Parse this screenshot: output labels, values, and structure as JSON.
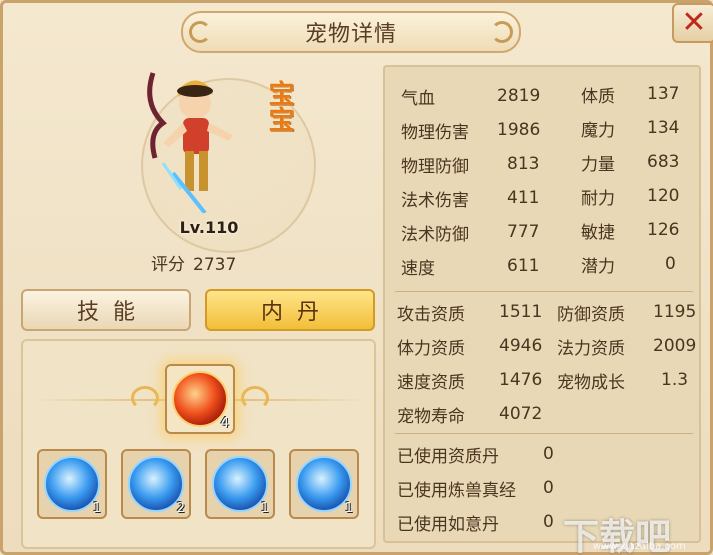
{
  "window": {
    "title": "宠物详情",
    "close_label": "✕"
  },
  "pet": {
    "badge": "宝宝",
    "level": "Lv.110",
    "score_label": "评分",
    "score_value": "2737"
  },
  "tabs": {
    "skill": "技能",
    "neidan": "内丹",
    "active": "neidan"
  },
  "neidan": {
    "main": {
      "count": "4",
      "color": "#e8451a"
    },
    "slots": [
      {
        "count": "1"
      },
      {
        "count": "2"
      },
      {
        "count": "1"
      },
      {
        "count": "1"
      }
    ]
  },
  "stats": {
    "basic_left": [
      {
        "label": "气血",
        "value": "2819"
      },
      {
        "label": "物理伤害",
        "value": "1986"
      },
      {
        "label": "物理防御",
        "value": "813"
      },
      {
        "label": "法术伤害",
        "value": "411"
      },
      {
        "label": "法术防御",
        "value": "777"
      },
      {
        "label": "速度",
        "value": "611"
      }
    ],
    "basic_right": [
      {
        "label": "体质",
        "value": "137"
      },
      {
        "label": "魔力",
        "value": "134"
      },
      {
        "label": "力量",
        "value": "683"
      },
      {
        "label": "耐力",
        "value": "120"
      },
      {
        "label": "敏捷",
        "value": "126"
      },
      {
        "label": "潜力",
        "value": "0"
      }
    ],
    "aptitude": [
      {
        "label": "攻击资质",
        "value": "1511"
      },
      {
        "label": "防御资质",
        "value": "1195"
      },
      {
        "label": "体力资质",
        "value": "4946"
      },
      {
        "label": "法力资质",
        "value": "2009"
      },
      {
        "label": "速度资质",
        "value": "1476"
      },
      {
        "label": "宠物成长",
        "value": "1.3"
      },
      {
        "label": "宠物寿命",
        "value": "4072"
      }
    ],
    "usage": [
      {
        "label": "已使用资质丹",
        "value": "0"
      },
      {
        "label": "已使用炼兽真经",
        "value": "0"
      },
      {
        "label": "已使用如意丹",
        "value": "0"
      }
    ]
  },
  "watermark": {
    "text": "下载吧",
    "url": "www.xiazaiba.com"
  }
}
